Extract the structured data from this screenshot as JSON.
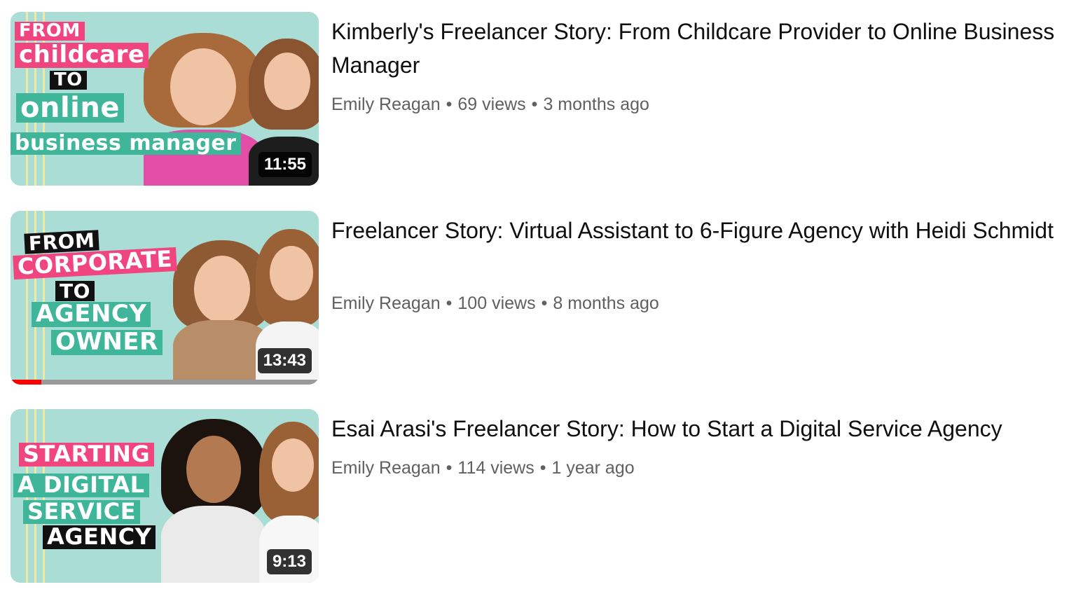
{
  "videos": [
    {
      "title": "Kimberly's Freelancer Story: From Childcare Provider to Online Business Manager",
      "channel": "Emily Reagan",
      "views": "69 views",
      "age": "3 months ago",
      "duration": "11:55",
      "thumb_lines": [
        "FROM",
        "childcare",
        "TO",
        "online",
        "business manager"
      ]
    },
    {
      "title": "Freelancer Story: Virtual Assistant to 6-Figure Agency with Heidi Schmidt",
      "channel": "Emily Reagan",
      "views": "100 views",
      "age": "8 months ago",
      "duration": "13:43",
      "watched_progress": 0.1,
      "thumb_lines": [
        "FROM",
        "CORPORATE",
        "TO",
        "AGENCY",
        "OWNER"
      ]
    },
    {
      "title": "Esai Arasi's Freelancer Story: How to Start a Digital Service Agency",
      "channel": "Emily Reagan",
      "views": "114 views",
      "age": "1 year ago",
      "duration": "9:13",
      "thumb_lines": [
        "STARTING",
        "A DIGITAL",
        "SERVICE",
        "AGENCY"
      ]
    }
  ],
  "separator": "•",
  "colors": {
    "thumb_bg": "#a9ddd6",
    "pink": "#f0457f",
    "green": "#3fb59a",
    "progress": "#ff0000",
    "meta_text": "#606060"
  }
}
